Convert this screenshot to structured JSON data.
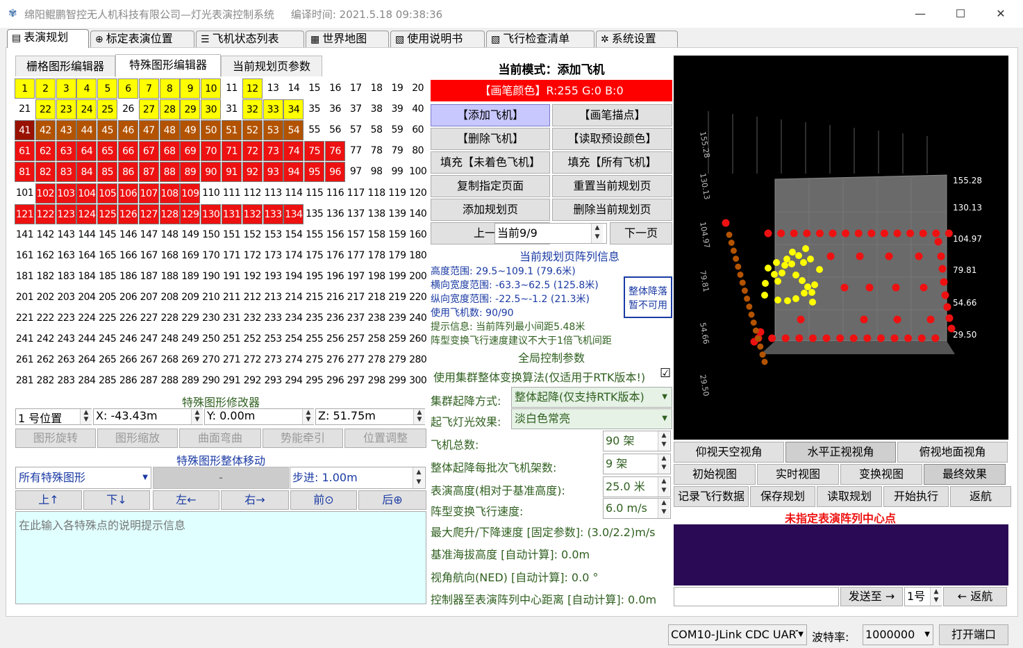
{
  "title": "绵阳鲲鹏智控无人机科技有限公司—灯光表演控制系统",
  "compile_time": "编译时间: 2021.5.18 09:38:36",
  "window_controls": {
    "min": "—",
    "max": "☐",
    "close": "✕"
  },
  "main_tabs": [
    {
      "label": "表演规划",
      "icon": "▤"
    },
    {
      "label": "标定表演位置",
      "icon": "⊕"
    },
    {
      "label": "飞机状态列表",
      "icon": "☰"
    },
    {
      "label": "世界地图",
      "icon": "▦"
    },
    {
      "label": "使用说明书",
      "icon": "▧"
    },
    {
      "label": "飞行检查清单",
      "icon": "▧"
    },
    {
      "label": "系统设置",
      "icon": "✲"
    }
  ],
  "sub_tabs": [
    "栅格图形编辑器",
    "特殊图形编辑器",
    "当前规划页参数"
  ],
  "grid": {
    "yellow": [
      1,
      2,
      3,
      4,
      5,
      6,
      7,
      8,
      9,
      10,
      12,
      22,
      23,
      24,
      25,
      27,
      28,
      29,
      30,
      32,
      33,
      34
    ],
    "brown": [
      42,
      43,
      44,
      45,
      46,
      47,
      48,
      49,
      50,
      51,
      52,
      53,
      54
    ],
    "dark_red": [
      41
    ],
    "red": [
      61,
      62,
      63,
      64,
      65,
      66,
      67,
      68,
      69,
      70,
      71,
      72,
      73,
      74,
      75,
      76,
      81,
      82,
      83,
      84,
      85,
      86,
      87,
      88,
      89,
      90,
      91,
      92,
      93,
      94,
      95,
      96,
      102,
      103,
      104,
      105,
      106,
      107,
      108,
      109,
      121,
      122,
      123,
      124,
      125,
      126,
      127,
      128,
      129,
      130,
      131,
      132,
      133,
      134
    ],
    "count": 300,
    "colors": {
      "yellow": "#ffff00",
      "brown": "#b35300",
      "red": "#ee1111",
      "dark_red": "#991100"
    }
  },
  "shape_modifier": {
    "title": "特殊图形修改器",
    "position": "1 号位置",
    "x": "X:  -43.43m",
    "y": "Y:  0.00m",
    "z": "Z:  51.75m",
    "buttons": [
      "图形旋转",
      "图形缩放",
      "曲面弯曲",
      "势能牵引",
      "位置调整"
    ]
  },
  "shape_move": {
    "title": "特殊图形整体移动",
    "select": "所有特殊图形",
    "center": "-",
    "step": "步进: 1.00m",
    "buttons": [
      "上↑",
      "下↓",
      "左←",
      "右→",
      "前⊙",
      "后⊕"
    ],
    "note_placeholder": "在此输入各特殊点的说明提示信息"
  },
  "mode": {
    "title": "当前模式：添加飞机",
    "brush_color": "【画笔颜色】R:255 G:0 B:0",
    "brush_hex": "#ff0000",
    "buttons": [
      [
        "【添加飞机】",
        "【画笔描点】"
      ],
      [
        "【删除飞机】",
        "【读取预设颜色】"
      ],
      [
        "填充【未着色飞机】",
        "填充【所有飞机】"
      ],
      [
        "复制指定页面",
        "重置当前规划页"
      ],
      [
        "添加规划页",
        "删除当前规划页"
      ]
    ],
    "prev": "上一页",
    "page": "当前9/9",
    "next": "下一页"
  },
  "formation_info": {
    "title": "当前规划页阵列信息",
    "lines": [
      "高度范围:  29.5~109.1 (79.6米)",
      "横向宽度范围:  -63.3~62.5 (125.8米)",
      "纵向宽度范围:  -22.5~-1.2 (21.3米)",
      "使用飞机数:  90/90"
    ],
    "hint1": "提示信息:  当前阵列最小间距5.48米",
    "hint2": "阵型变换飞行速度建议不大于1倍飞机间距",
    "land_btn": [
      "整体降落",
      "暂不可用"
    ]
  },
  "global": {
    "title": "全局控制参数",
    "cluster_algo": "使用集群整体变换算法(仅适用于RTK版本!)",
    "cluster_checked": "☑",
    "takeoff_mode_label": "集群起降方式:",
    "takeoff_mode": "整体起降(仅支持RTK版本)",
    "light_label": "起飞灯光效果:",
    "light": "淡白色常亮",
    "total_label": "飞机总数:",
    "total": "90 架",
    "batch_label": "整体起降每批次飞机架数:",
    "batch": "9 架",
    "height_label": "表演高度(相对于基准高度):",
    "height": "25.0 米",
    "speed_label": "阵型变换飞行速度:",
    "speed": "6.0 m/s",
    "climb": "最大爬升/下降速度 [固定参数]: (3.0/2.2)m/s",
    "altitude": "基准海拔高度 [自动计算]: 0.0m",
    "heading": "视角航向(NED) [自动计算]: 0.0 °",
    "distance": "控制器至表演阵列中心距离 [自动计算]: 0.0m"
  },
  "view": {
    "axis_right": [
      "155.28",
      "130.13",
      "104.97",
      "79.81",
      "54.66",
      "29.50"
    ],
    "axis_left": [
      "155.28",
      "130.13",
      "104.97",
      "79.81",
      "54.66",
      "29.50"
    ],
    "angle_buttons": [
      "仰视天空视角",
      "水平正视视角",
      "俯视地面视角"
    ],
    "view_buttons": [
      "初始视图",
      "实时视图",
      "变换视图",
      "最终效果"
    ],
    "action_buttons": [
      "记录飞行数据",
      "保存规划",
      "读取规划",
      "开始执行",
      "返航"
    ],
    "warning": "未指定表演阵列中心点",
    "send": "发送至 →",
    "target": "1号",
    "return": "← 返航"
  },
  "statusbar": {
    "port": "COM10-JLink CDC UART",
    "baud_label": "波特率:",
    "baud": "1000000",
    "open": "打开端口"
  }
}
